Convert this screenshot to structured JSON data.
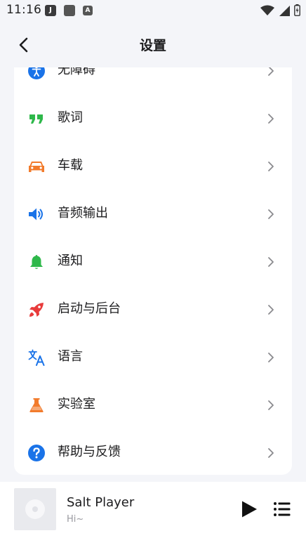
{
  "status_bar": {
    "time": "11:16",
    "notification_icons": [
      {
        "name": "j-app-icon",
        "glyph": "J"
      },
      {
        "name": "square-app-icon",
        "glyph": ""
      },
      {
        "name": "a-app-icon",
        "glyph": "A"
      }
    ],
    "system_icons": [
      "wifi-icon",
      "cellular-signal-icon",
      "battery-icon"
    ]
  },
  "header": {
    "title": "设置",
    "back_icon": "chevron-left-icon"
  },
  "settings": {
    "items": [
      {
        "label": "无障碍",
        "icon": "accessibility-icon",
        "color": "#1a73e8"
      },
      {
        "label": "歌词",
        "icon": "quote-icon",
        "color": "#2eb84a"
      },
      {
        "label": "车载",
        "icon": "car-icon",
        "color": "#f27b2c"
      },
      {
        "label": "音频输出",
        "icon": "speaker-icon",
        "color": "#1a73e8"
      },
      {
        "label": "通知",
        "icon": "bell-icon",
        "color": "#2eb84a"
      },
      {
        "label": "启动与后台",
        "icon": "rocket-icon",
        "color": "#e83b3b"
      },
      {
        "label": "语言",
        "icon": "translate-icon",
        "color": "#1a73e8"
      },
      {
        "label": "实验室",
        "icon": "flask-icon",
        "color": "#f27b2c"
      },
      {
        "label": "帮助与反馈",
        "icon": "help-icon",
        "color": "#1a73e8"
      }
    ],
    "chevron_icon": "chevron-right-icon"
  },
  "mini_player": {
    "title": "Salt Player",
    "subtitle": "Hi~",
    "art_icon": "album-disc-icon",
    "play_icon": "play-icon",
    "queue_icon": "playlist-icon"
  }
}
